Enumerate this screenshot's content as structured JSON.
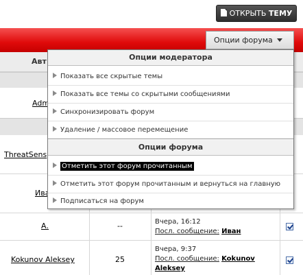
{
  "top_button": {
    "label_prefix": "ОТКРЫТЬ ",
    "label_bold": "ТЕМУ"
  },
  "forum_options_button": {
    "label": "Опции форума"
  },
  "table": {
    "column_author_partial": "Авт",
    "rows": [
      {
        "author": "Adm",
        "count": "",
        "last_date": "",
        "last_prefix": "",
        "last_user": ""
      },
      {
        "author": "ThreatSens",
        "count": "",
        "last_date": "",
        "last_prefix": "",
        "last_user": ""
      },
      {
        "author": "Ива",
        "count": "",
        "last_date": "",
        "last_prefix": "",
        "last_user": ""
      },
      {
        "author": "А.",
        "count": "--",
        "last_date": "Вчера, 16:12",
        "last_prefix": "Посл. сообщение:",
        "last_user": "Иван"
      },
      {
        "author": "Kokunov Aleksey",
        "count": "25",
        "last_date": "Вчера, 9:37",
        "last_prefix": "Посл. сообщение:",
        "last_user": "Kokunov",
        "last_user_2": "Aleksey"
      }
    ]
  },
  "menu": {
    "moderator_header": "Опции модератора",
    "moderator_items": [
      "Показать все скрытые темы",
      "Показать все темы со скрытыми сообщениями",
      "Синхронизировать форум",
      "Удаление / массовое перемещение"
    ],
    "forum_header": "Опции форума",
    "forum_items": [
      "Отметить этот форум прочитанным",
      "Отметить этот форум прочитанным и вернуться на главную",
      "Подписаться на форум"
    ],
    "selected_index": 0
  }
}
